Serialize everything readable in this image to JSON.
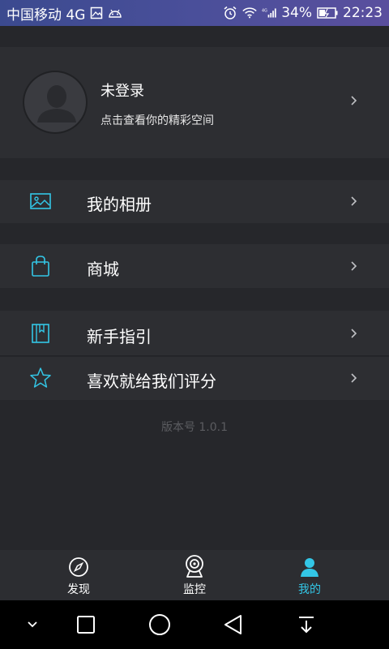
{
  "status_bar": {
    "carrier": "中国移动 4G",
    "battery": "34%",
    "time": "22:23"
  },
  "profile": {
    "name": "未登录",
    "subtitle": "点击查看你的精彩空间"
  },
  "menu": {
    "album": "我的相册",
    "shop": "商城",
    "guide": "新手指引",
    "rate": "喜欢就给我们评分"
  },
  "version": "版本号 1.0.1",
  "tabs": [
    {
      "label": "发现",
      "icon": "compass-icon"
    },
    {
      "label": "监控",
      "icon": "webcam-icon"
    },
    {
      "label": "我的",
      "icon": "user-icon",
      "active": true
    }
  ],
  "colors": {
    "accent": "#33c6e6",
    "background": "#26272b",
    "panel": "#2d2e32"
  }
}
